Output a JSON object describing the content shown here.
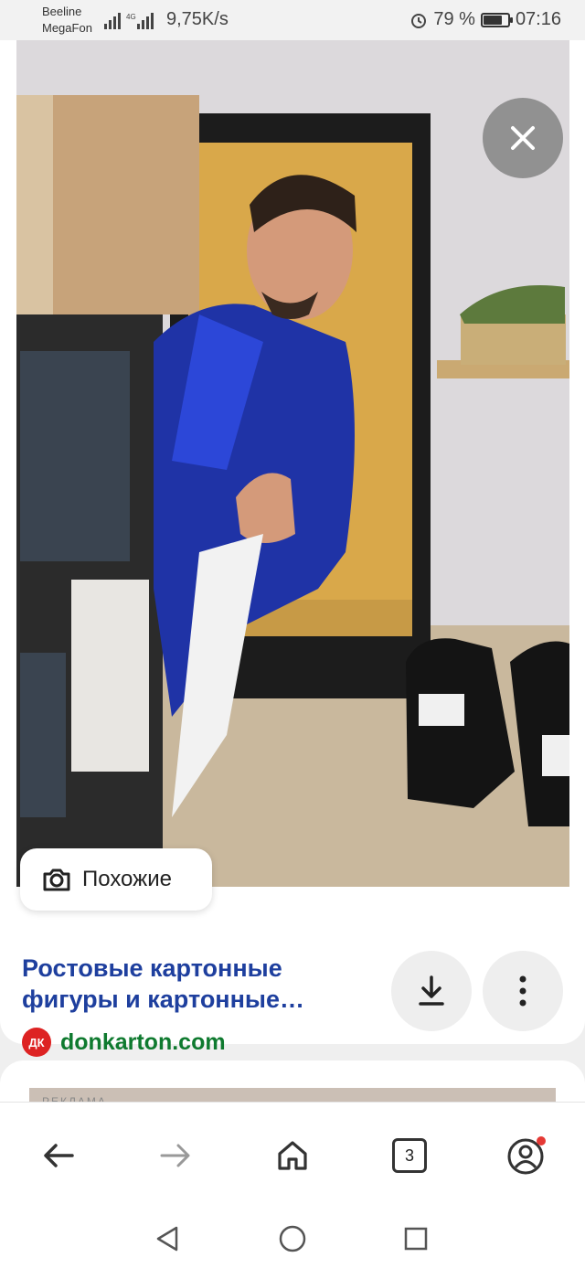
{
  "status_bar": {
    "carrier_1": "Beeline",
    "carrier_2": "MegaFon",
    "speed": "9,75K/s",
    "battery": "79 %",
    "battery_level": 0.79,
    "time": "07:16"
  },
  "result": {
    "similar_label": "Похожие",
    "title": "Ростовые картонные фигуры и картонные…",
    "favicon_text": "ДК",
    "source": "donkarton.com"
  },
  "next_result": {
    "ad_label": "РЕКЛАМА"
  },
  "bottom_nav": {
    "tabs_count": "3"
  },
  "colors": {
    "title": "#1e3f9e",
    "source": "#0f7a2f",
    "favicon": "#dd2222",
    "notification_dot": "#e53935"
  },
  "icons": [
    "signal-icon",
    "alarm-icon",
    "battery-icon",
    "close-icon",
    "lens-icon",
    "download-icon",
    "more-vert-icon",
    "back-arrow-icon",
    "forward-arrow-icon",
    "home-icon",
    "tabs-icon",
    "profile-icon",
    "nav-back-icon",
    "nav-home-icon",
    "nav-recents-icon"
  ]
}
